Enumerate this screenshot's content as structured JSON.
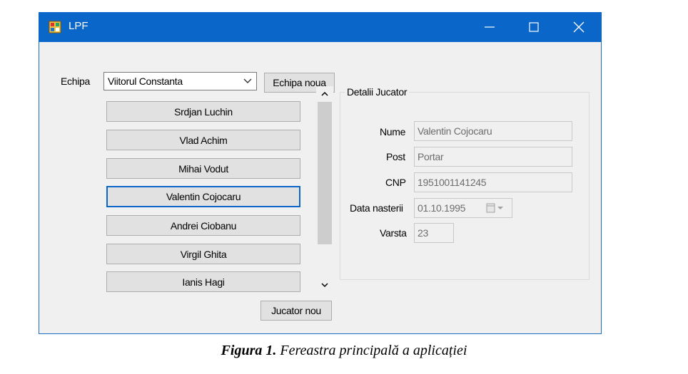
{
  "window": {
    "title": "LPF",
    "controls": {
      "minimize": "—",
      "maximize": "☐",
      "close": "✕"
    }
  },
  "team": {
    "label": "Echipa",
    "selected": "Viitorul Constanta",
    "new_team_button": "Echipa noua"
  },
  "players": [
    {
      "name": "Srdjan Luchin"
    },
    {
      "name": "Vlad Achim"
    },
    {
      "name": "Mihai Vodut"
    },
    {
      "name": "Valentin Cojocaru"
    },
    {
      "name": "Andrei Ciobanu"
    },
    {
      "name": "Virgil Ghita"
    },
    {
      "name": "Ianis Hagi"
    }
  ],
  "new_player_button": "Jucator nou",
  "details": {
    "group_title": "Detalii Jucator",
    "name_label": "Nume",
    "name_value": "Valentin Cojocaru",
    "position_label": "Post",
    "position_value": "Portar",
    "cnp_label": "CNP",
    "cnp_value": "1951001141245",
    "birth_label": "Data nasterii",
    "birth_value": "01.10.1995",
    "age_label": "Varsta",
    "age_value": "23"
  },
  "caption": {
    "bold": "Figura 1.",
    "text": "Fereastra principală a aplicației"
  },
  "colors": {
    "titlebar": "#0a66c8",
    "focus_border": "#0a66c8",
    "client_bg": "#f0f0f0"
  }
}
